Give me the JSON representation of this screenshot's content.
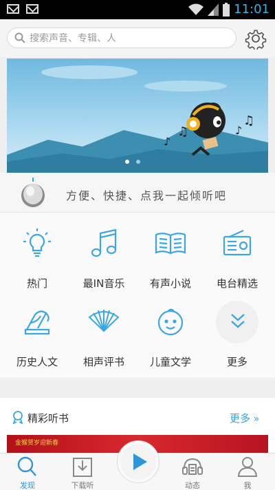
{
  "status_bar": {
    "time": "11:01"
  },
  "search": {
    "placeholder": "搜索声音、专辑、人"
  },
  "knob_text": "方便、快捷、点我一起倾听吧",
  "categories": [
    {
      "label": "热门",
      "icon": "lightbulb-icon"
    },
    {
      "label": "最IN音乐",
      "icon": "music-note-icon"
    },
    {
      "label": "有声小说",
      "icon": "book-icon"
    },
    {
      "label": "电台精选",
      "icon": "radio-icon"
    },
    {
      "label": "历史人文",
      "icon": "history-books-icon"
    },
    {
      "label": "相声评书",
      "icon": "fan-icon"
    },
    {
      "label": "儿童文学",
      "icon": "child-face-icon"
    },
    {
      "label": "更多",
      "icon": "chevron-double-down-icon"
    }
  ],
  "section": {
    "title": "精彩听书",
    "more": "更多",
    "banner_text": "金猴贺岁迎新春"
  },
  "nav": {
    "discover": "发现",
    "downloads": "下载听",
    "activity": "动态",
    "me": "我"
  },
  "colors": {
    "accent": "#2f95d6",
    "banner_sky": "#6fb9df",
    "banner_mountain": "#3c8fb0"
  }
}
